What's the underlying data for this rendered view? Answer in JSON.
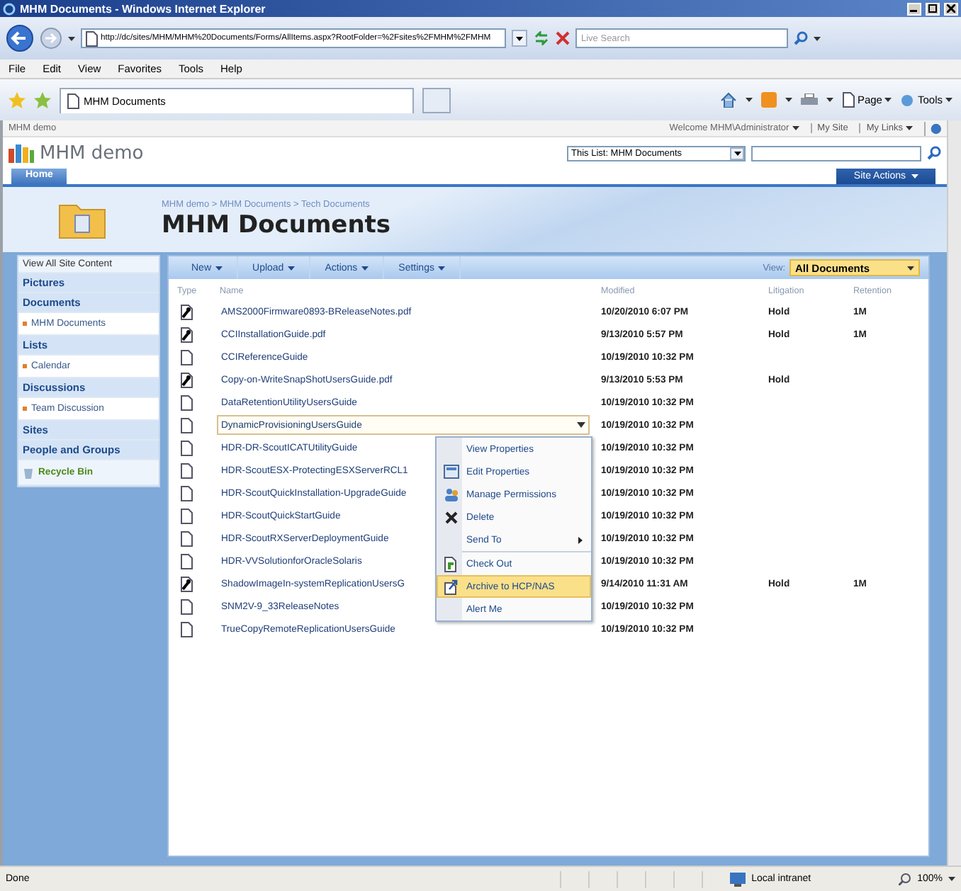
{
  "window": {
    "title": "MHM Documents - Windows Internet Explorer"
  },
  "address_bar": {
    "url": "http://dc/sites/MHM/MHM%20Documents/Forms/AllItems.aspx?RootFolder=%2Fsites%2FMHM%2FMHM",
    "search_placeholder": "Live Search"
  },
  "menu_bar": [
    "File",
    "Edit",
    "View",
    "Favorites",
    "Tools",
    "Help"
  ],
  "browser_tabs": [
    {
      "label": "MHM Documents",
      "selected": true
    }
  ],
  "command_bar": [
    "Page",
    "Tools"
  ],
  "site_top": {
    "site": "MHM demo",
    "welcome": "Welcome MHM\\Administrator",
    "links": [
      "My Site",
      "My Links"
    ]
  },
  "site_header": {
    "name": "MHM demo",
    "search_scope": "This List: MHM Documents",
    "site_actions": "Site Actions"
  },
  "top_tabs": [
    {
      "label": "Home",
      "selected": true
    }
  ],
  "breadcrumb": "MHM demo > MHM Documents > Tech Documents",
  "page_title": "MHM Documents",
  "left_nav": [
    {
      "kind": "link",
      "label": "View All Site Content"
    },
    {
      "kind": "header",
      "label": "Pictures"
    },
    {
      "kind": "header",
      "label": "Documents"
    },
    {
      "kind": "item",
      "label": "MHM Documents"
    },
    {
      "kind": "header",
      "label": "Lists"
    },
    {
      "kind": "item",
      "label": "Calendar"
    },
    {
      "kind": "header",
      "label": "Discussions"
    },
    {
      "kind": "item",
      "label": "Team Discussion"
    },
    {
      "kind": "header",
      "label": "Sites"
    },
    {
      "kind": "header",
      "label": "People and Groups"
    },
    {
      "kind": "recycle",
      "label": "Recycle Bin"
    }
  ],
  "toolbar": [
    "New",
    "Upload",
    "Actions",
    "Settings"
  ],
  "view": {
    "label": "View:",
    "value": "All Documents"
  },
  "table": {
    "columns": [
      "Type",
      "Name",
      "Modified",
      "Litigation",
      "Retention"
    ],
    "rows": [
      {
        "kind": "pdf",
        "name": "AMS2000Firmware0893-BReleaseNotes.pdf",
        "modified": "10/20/2010 6:07 PM",
        "litigation": "Hold",
        "retention": "1M",
        "selected": false
      },
      {
        "kind": "pdf",
        "name": "CCIInstallationGuide.pdf",
        "modified": "9/13/2010 5:57 PM",
        "litigation": "Hold",
        "retention": "1M",
        "selected": false
      },
      {
        "kind": "doc",
        "name": "CCIReferenceGuide",
        "modified": "10/19/2010 10:32 PM",
        "selected": false
      },
      {
        "kind": "pdf",
        "name": "Copy-on-WriteSnapShotUsersGuide.pdf",
        "modified": "9/13/2010 5:53 PM",
        "litigation": "Hold",
        "selected": false
      },
      {
        "kind": "doc",
        "name": "DataRetentionUtilityUsersGuide",
        "modified": "10/19/2010 10:32 PM",
        "selected": false
      },
      {
        "kind": "doc",
        "name": "DynamicProvisioningUsersGuide",
        "modified": "10/19/2010 10:32 PM",
        "selected": true
      },
      {
        "kind": "doc",
        "name": "HDR-DR-ScoutICATUtilityGuide",
        "modified": "10/19/2010 10:32 PM",
        "selected": false
      },
      {
        "kind": "doc",
        "name": "HDR-ScoutESX-ProtectingESXServerRCL1",
        "modified": "10/19/2010 10:32 PM",
        "selected": false
      },
      {
        "kind": "doc",
        "name": "HDR-ScoutQuickInstallation-UpgradeGuide",
        "modified": "10/19/2010 10:32 PM",
        "selected": false
      },
      {
        "kind": "doc",
        "name": "HDR-ScoutQuickStartGuide",
        "modified": "10/19/2010 10:32 PM",
        "selected": false
      },
      {
        "kind": "doc",
        "name": "HDR-ScoutRXServerDeploymentGuide",
        "modified": "10/19/2010 10:32 PM",
        "selected": false
      },
      {
        "kind": "doc",
        "name": "HDR-VVSolutionforOracleSolaris",
        "modified": "10/19/2010 10:32 PM",
        "selected": false
      },
      {
        "kind": "pdf",
        "name": "ShadowImageIn-systemReplicationUsersG",
        "modified": "9/14/2010 11:31 AM",
        "litigation": "Hold",
        "retention": "1M",
        "selected": false
      },
      {
        "kind": "doc",
        "name": "SNM2V-9_33ReleaseNotes",
        "modified": "10/19/2010 10:32 PM",
        "selected": false
      },
      {
        "kind": "doc",
        "name": "TrueCopyRemoteReplicationUsersGuide",
        "modified": "10/19/2010 10:32 PM",
        "selected": false
      }
    ]
  },
  "context_menu": {
    "items": [
      {
        "kind": "plain",
        "label": "View Properties",
        "selected": false
      },
      {
        "kind": "edit",
        "label": "Edit Properties",
        "selected": false
      },
      {
        "kind": "permissions",
        "label": "Manage Permissions",
        "selected": false
      },
      {
        "kind": "delete",
        "label": "Delete",
        "selected": false
      },
      {
        "kind": "submenu",
        "label": "Send To",
        "selected": false
      },
      {
        "kind": "checkout",
        "label": "Check Out",
        "selected": false
      },
      {
        "kind": "archive",
        "label": "Archive to HCP/NAS",
        "selected": true
      },
      {
        "kind": "plain",
        "label": "Alert Me",
        "selected": false
      }
    ]
  },
  "status_bar": {
    "text": "Done",
    "zone": "Local intranet",
    "zoom": "100%"
  }
}
